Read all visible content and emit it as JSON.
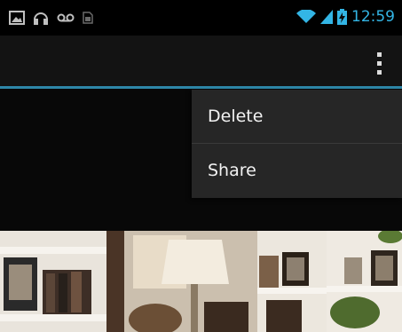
{
  "status_bar": {
    "time": "12:59",
    "icons": [
      "picture-icon",
      "headset-icon",
      "voicemail-icon",
      "sim-icon",
      "wifi-icon",
      "signal-icon",
      "battery-icon"
    ],
    "accent": "#33b5e5"
  },
  "action_bar": {
    "overflow_icon": "overflow-menu-icon",
    "divider_color": "#2e87a8"
  },
  "menu": {
    "items": [
      {
        "label": "Delete"
      },
      {
        "label": "Share"
      }
    ]
  },
  "photo": {
    "subject": "shelves-photo"
  }
}
